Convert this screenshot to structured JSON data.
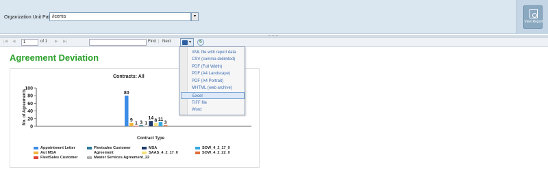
{
  "params": {
    "org_label": "Organization Unit Path",
    "org_value": "/icertis",
    "dropdown_arrow": "▾",
    "view_report_label": "View Report"
  },
  "toolbar": {
    "first": "|◀",
    "prev": "◀",
    "page_value": "1",
    "of_label": "of 1",
    "next": "▶",
    "last": "▶|",
    "find_label": "Find",
    "separator": "|",
    "next_label": "Next",
    "export_icon": "save-disk-icon",
    "refresh_icon": "refresh-icon"
  },
  "report": {
    "title": "Agreement Deviation"
  },
  "export_menu": {
    "items": [
      "XML file with report data",
      "CSV (comma delimited)",
      "PDF (Full Width)",
      "PDF (A4 Landscape)",
      "PDF (A4 Portrait)",
      "MHTML (web archive)",
      "Excel",
      "TIFF file",
      "Word"
    ],
    "highlighted": "Excel"
  },
  "chart_data": {
    "type": "bar",
    "title": "Contracts: All",
    "xlabel": "Contract Type",
    "ylabel": "No. of Agreements",
    "ylim": [
      0,
      100
    ],
    "yticks": [
      "0",
      "20",
      "40",
      "60",
      "80",
      "100"
    ],
    "categories": [
      "Contract Type"
    ],
    "series": [
      {
        "name": "Appointment Letter",
        "values": [
          80
        ],
        "color": "#3b8ce6",
        "label": "80"
      },
      {
        "name": "Aut MSA",
        "values": [
          9
        ],
        "color": "#f2b33d",
        "label": "9"
      },
      {
        "name": "FleetSales Customer",
        "values": [
          1
        ],
        "color": "#e0423a",
        "label": "1"
      },
      {
        "name": "Fleetsales Customer Agreement",
        "values": [
          3
        ],
        "color": "#2a7a9a",
        "label": "3"
      },
      {
        "name": "Master Services Agreement_22",
        "values": [
          1
        ],
        "color": "#b0b0b0",
        "label": "1"
      },
      {
        "name": "MSA",
        "values": [
          14
        ],
        "color": "#1e3a6a",
        "label": "14"
      },
      {
        "name": "SAAS_4_2_17_0",
        "values": [
          8
        ],
        "color": "#f7e07a",
        "label": "8"
      },
      {
        "name": "SOW_4_2_17_0",
        "values": [
          11
        ],
        "color": "#34a8e0",
        "label": "11"
      },
      {
        "name": "SOW_4_2_22_0",
        "values": [
          3
        ],
        "color": "#e0703a",
        "label": "3"
      }
    ],
    "grid": false,
    "legend_position": "bottom"
  }
}
